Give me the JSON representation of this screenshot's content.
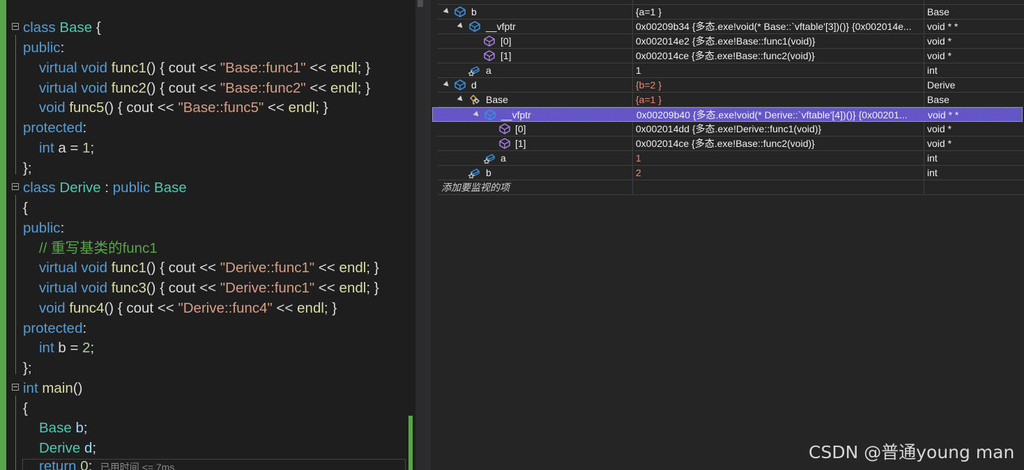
{
  "editor": {
    "lines": [
      {
        "id": "l1"
      },
      {
        "id": "l2"
      }
    ],
    "code": {
      "l01": {
        "a": "class",
        "b": "Base",
        "c": " {"
      },
      "l02": {
        "a": "public",
        "b": ":"
      },
      "l03": {
        "a": "virtual",
        "b": "void",
        "c": "func1",
        "d": "() { ",
        "e": "cout",
        "f": " << ",
        "g": "\"Base::func1\"",
        "h": " << ",
        "i": "endl",
        "j": "; }"
      },
      "l04": {
        "a": "virtual",
        "b": "void",
        "c": "func2",
        "d": "() { ",
        "e": "cout",
        "f": " << ",
        "g": "\"Base::func2\"",
        "h": " << ",
        "i": "endl",
        "j": "; }"
      },
      "l05": {
        "a": "void",
        "c": "func5",
        "d": "() { ",
        "e": "cout",
        "f": " << ",
        "g": "\"Base::func5\"",
        "h": " << ",
        "i": "endl",
        "j": "; }"
      },
      "l06": {
        "a": "protected",
        "b": ":"
      },
      "l07": {
        "a": "int",
        "b": "a",
        "c": " = ",
        "d": "1",
        "e": ";"
      },
      "l08": {
        "a": "};"
      },
      "l09": {
        "a": "class",
        "b": "Derive",
        "c": " : ",
        "d": "public",
        "e": "Base"
      },
      "l10": {
        "a": "{"
      },
      "l11": {
        "a": "public",
        "b": ":"
      },
      "l12": {
        "a": "// 重写基类的func1"
      },
      "l13": {
        "a": "virtual",
        "b": "void",
        "c": "func1",
        "d": "() { ",
        "e": "cout",
        "f": " << ",
        "g": "\"Derive::func1\"",
        "h": " << ",
        "i": "endl",
        "j": "; }"
      },
      "l14": {
        "a": "virtual",
        "b": "void",
        "c": "func3",
        "d": "() { ",
        "e": "cout",
        "f": " << ",
        "g": "\"Derive::func1\"",
        "h": " << ",
        "i": "endl",
        "j": "; }"
      },
      "l15": {
        "a": "void",
        "c": "func4",
        "d": "() { ",
        "e": "cout",
        "f": " << ",
        "g": "\"Derive::func4\"",
        "h": " << ",
        "i": "endl",
        "j": "; }"
      },
      "l16": {
        "a": "protected",
        "b": ":"
      },
      "l17": {
        "a": "int",
        "b": "b",
        "c": " = ",
        "d": "2",
        "e": ";"
      },
      "l18": {
        "a": "};"
      },
      "l19": {
        "a": "int",
        "b": "main",
        "c": "()"
      },
      "l20": {
        "a": "{"
      },
      "l21": {
        "a": "Base",
        "b": "b",
        "c": ";"
      },
      "l22": {
        "a": "Derive",
        "b": "d",
        "c": ";"
      },
      "l23": {
        "a": "return",
        "b": "0",
        "c": ";",
        "d": "已用时间 <= 7ms"
      }
    }
  },
  "watch": {
    "rows": [
      {
        "name": "b",
        "value": "{a=1 }",
        "type": "Base"
      },
      {
        "name": "__vfptr",
        "value": "0x00209b34 {多态.exe!void(* Base::`vftable'[3])()} {0x002014e...",
        "type": "void * *"
      },
      {
        "name": "[0]",
        "value": "0x002014e2 {多态.exe!Base::func1(void)}",
        "type": "void *"
      },
      {
        "name": "[1]",
        "value": "0x002014ce {多态.exe!Base::func2(void)}",
        "type": "void *"
      },
      {
        "name": "a",
        "value": "1",
        "type": "int"
      },
      {
        "name": "d",
        "value": "{b=2 }",
        "type": "Derive"
      },
      {
        "name": "Base",
        "value": "{a=1 }",
        "type": "Base"
      },
      {
        "name": "__vfptr",
        "value": "0x00209b40 {多态.exe!void(* Derive::`vftable'[4])()} {0x00201...",
        "type": "void * *"
      },
      {
        "name": "[0]",
        "value": "0x002014dd {多态.exe!Derive::func1(void)}",
        "type": "void *"
      },
      {
        "name": "[1]",
        "value": "0x002014ce {多态.exe!Base::func2(void)}",
        "type": "void *"
      },
      {
        "name": "a",
        "value": "1",
        "type": "int"
      },
      {
        "name": "b",
        "value": "2",
        "type": "int"
      }
    ],
    "add_item": "添加要监视的项"
  },
  "watermark": "CSDN @普通young man",
  "colors": {
    "selection": "#6457c5",
    "changed_value": "#f48771",
    "icon_blue": "#3c8fd8",
    "icon_purple": "#a883e3"
  }
}
